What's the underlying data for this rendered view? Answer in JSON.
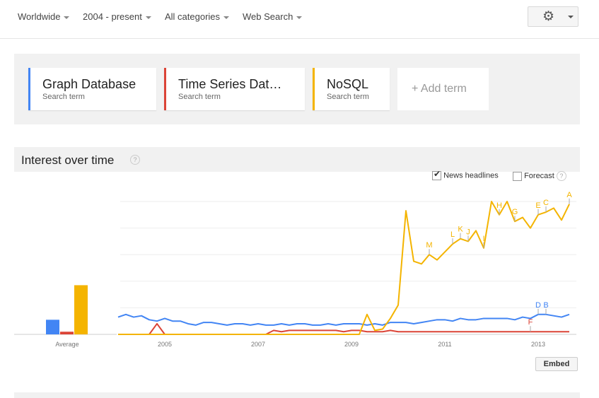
{
  "filters": [
    {
      "label": "Worldwide"
    },
    {
      "label": "2004 - present"
    },
    {
      "label": "All categories"
    },
    {
      "label": "Web Search"
    }
  ],
  "terms": [
    {
      "title": "Graph Database",
      "subtitle": "Search term",
      "color": "#4285f4"
    },
    {
      "title": "Time Series Dat…",
      "subtitle": "Search term",
      "color": "#db4437"
    },
    {
      "title": "NoSQL",
      "subtitle": "Search term",
      "color": "#f4b400"
    }
  ],
  "add_term": "+ Add term",
  "section_title": "Interest over time",
  "help": "?",
  "options": {
    "news": "News headlines",
    "news_checked": true,
    "forecast": "Forecast",
    "forecast_checked": false
  },
  "embed": "Embed",
  "chart_data": {
    "type": "line",
    "ylim": [
      0,
      100
    ],
    "grid": true,
    "x_ticks": [
      "2005",
      "2007",
      "2009",
      "2011",
      "2013"
    ],
    "average_label": "Average",
    "averages": [
      11,
      2,
      37
    ],
    "x": [
      "2004-01",
      "2004-03",
      "2004-05",
      "2004-07",
      "2004-09",
      "2004-11",
      "2005-01",
      "2005-03",
      "2005-05",
      "2005-07",
      "2005-09",
      "2005-11",
      "2006-01",
      "2006-03",
      "2006-05",
      "2006-07",
      "2006-09",
      "2006-11",
      "2007-01",
      "2007-03",
      "2007-05",
      "2007-07",
      "2007-09",
      "2007-11",
      "2008-01",
      "2008-03",
      "2008-05",
      "2008-07",
      "2008-09",
      "2008-11",
      "2009-01",
      "2009-03",
      "2009-05",
      "2009-07",
      "2009-09",
      "2009-11",
      "2010-01",
      "2010-03",
      "2010-05",
      "2010-07",
      "2010-09",
      "2010-11",
      "2011-01",
      "2011-03",
      "2011-05",
      "2011-07",
      "2011-09",
      "2011-11",
      "2012-01",
      "2012-03",
      "2012-05",
      "2012-07",
      "2012-09",
      "2012-11",
      "2013-01",
      "2013-03",
      "2013-05",
      "2013-07",
      "2013-09"
    ],
    "series": [
      {
        "name": "Graph Database",
        "color": "#4285f4",
        "values": [
          13,
          15,
          13,
          14,
          11,
          10,
          12,
          10,
          10,
          8,
          7,
          9,
          9,
          8,
          7,
          8,
          8,
          7,
          8,
          7,
          7,
          8,
          7,
          8,
          8,
          7,
          7,
          8,
          7,
          8,
          8,
          8,
          7,
          8,
          7,
          9,
          9,
          9,
          8,
          9,
          10,
          11,
          11,
          10,
          12,
          11,
          11,
          12,
          12,
          12,
          12,
          11,
          13,
          12,
          15,
          15,
          14,
          13,
          15
        ]
      },
      {
        "name": "Time Series Dat…",
        "color": "#db4437",
        "values": [
          0,
          0,
          0,
          0,
          0,
          8,
          0,
          0,
          0,
          0,
          0,
          0,
          0,
          0,
          0,
          0,
          0,
          0,
          0,
          0,
          3,
          2,
          3,
          3,
          3,
          3,
          3,
          3,
          3,
          2,
          3,
          3,
          2,
          2,
          2,
          3,
          2,
          2,
          2,
          2,
          2,
          2,
          2,
          2,
          2,
          2,
          2,
          2,
          2,
          2,
          2,
          2,
          2,
          2,
          2,
          2,
          2,
          2,
          2
        ]
      },
      {
        "name": "NoSQL",
        "color": "#f4b400",
        "values": [
          0,
          0,
          0,
          0,
          0,
          0,
          0,
          0,
          0,
          0,
          0,
          0,
          0,
          0,
          0,
          0,
          0,
          0,
          0,
          0,
          0,
          0,
          0,
          0,
          0,
          0,
          0,
          0,
          0,
          0,
          0,
          0,
          15,
          3,
          4,
          12,
          22,
          93,
          55,
          53,
          60,
          56,
          62,
          68,
          72,
          70,
          78,
          65,
          100,
          90,
          100,
          85,
          88,
          80,
          90,
          92,
          95,
          86,
          98
        ]
      }
    ],
    "annotations": [
      {
        "letter": "M",
        "x": "2010-09",
        "series": 2
      },
      {
        "letter": "L",
        "x": "2011-03",
        "series": 2
      },
      {
        "letter": "K",
        "x": "2011-05",
        "series": 2
      },
      {
        "letter": "J",
        "x": "2011-07",
        "series": 2
      },
      {
        "letter": "I",
        "x": "2011-11",
        "series": 2
      },
      {
        "letter": "H",
        "x": "2012-03",
        "series": 2
      },
      {
        "letter": "G",
        "x": "2012-07",
        "series": 2
      },
      {
        "letter": "E",
        "x": "2013-01",
        "series": 2
      },
      {
        "letter": "C",
        "x": "2013-03",
        "series": 2
      },
      {
        "letter": "A",
        "x": "2013-09",
        "series": 2
      },
      {
        "letter": "D",
        "x": "2013-01",
        "series": 0
      },
      {
        "letter": "B",
        "x": "2013-03",
        "series": 0
      },
      {
        "letter": "F",
        "x": "2012-11",
        "series": 1
      }
    ]
  }
}
